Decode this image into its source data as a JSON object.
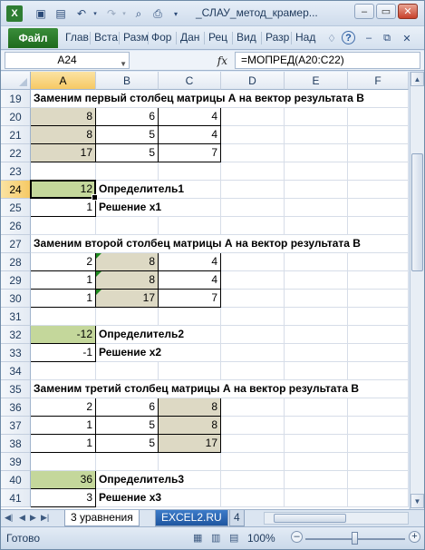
{
  "window": {
    "title": "_СЛАУ_метод_крамер...",
    "minimize_icon": "minimize-icon",
    "maximize_icon": "maximize-icon",
    "close_icon": "close-icon"
  },
  "quick_access": [
    "save-icon",
    "print-preview-icon",
    "undo-icon",
    "redo-icon",
    "preview-icon",
    "print-icon"
  ],
  "ribbon": {
    "file_label": "Файл",
    "tabs": [
      "Глав",
      "Вста",
      "Разм",
      "Фор",
      "Дан",
      "Рец",
      "Вид",
      "Разр",
      "Над"
    ],
    "file_color": "#2e7d32"
  },
  "formula_bar": {
    "name_box": "A24",
    "fx_label": "fx",
    "formula": "=МОПРЕД(A20:C22)"
  },
  "columns": [
    "A",
    "B",
    "C",
    "D",
    "E",
    "F"
  ],
  "rows": [
    {
      "n": "19",
      "label": "Заменим первый столбец матрицы А на вектор результата В"
    },
    {
      "n": "20",
      "a": "8",
      "b": "6",
      "c": "4"
    },
    {
      "n": "21",
      "a": "8",
      "b": "5",
      "c": "4"
    },
    {
      "n": "22",
      "a": "17",
      "b": "5",
      "c": "7"
    },
    {
      "n": "23"
    },
    {
      "n": "24",
      "a": "12",
      "b": "Определитель1"
    },
    {
      "n": "25",
      "a": "1",
      "b": "Решение х1"
    },
    {
      "n": "26"
    },
    {
      "n": "27",
      "label": "Заменим второй столбец матрицы А на вектор результата В"
    },
    {
      "n": "28",
      "a": "2",
      "b": "8",
      "c": "4"
    },
    {
      "n": "29",
      "a": "1",
      "b": "8",
      "c": "4"
    },
    {
      "n": "30",
      "a": "1",
      "b": "17",
      "c": "7"
    },
    {
      "n": "31"
    },
    {
      "n": "32",
      "a": "-12",
      "b": "Определитель2"
    },
    {
      "n": "33",
      "a": "-1",
      "b": "Решение х2"
    },
    {
      "n": "34"
    },
    {
      "n": "35",
      "label": "Заменим третий столбец матрицы А на вектор результата В"
    },
    {
      "n": "36",
      "a": "2",
      "b": "6",
      "c": "8"
    },
    {
      "n": "37",
      "a": "1",
      "b": "5",
      "c": "8"
    },
    {
      "n": "38",
      "a": "1",
      "b": "5",
      "c": "17"
    },
    {
      "n": "39"
    },
    {
      "n": "40",
      "a": "36",
      "b": "Определитель3"
    },
    {
      "n": "41",
      "a": "3",
      "b": "Решение х3"
    }
  ],
  "sheet_tabs": [
    "3 уравнения",
    "EXCEL2.RU",
    "4"
  ],
  "status": {
    "ready": "Готово",
    "zoom": "100%",
    "zoom_level_percent": 100
  },
  "colors": {
    "tan_fill": "#ddd9c4",
    "green_fill": "#c4d79b",
    "selection_header": "#f6c964"
  }
}
